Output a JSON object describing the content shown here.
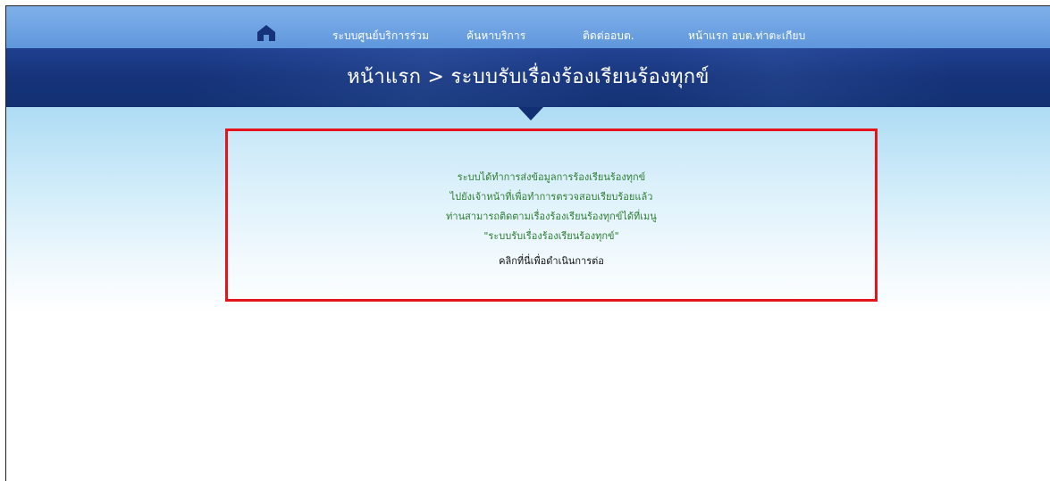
{
  "nav": {
    "home_icon": "home-icon",
    "items": [
      {
        "label": "ระบบศูนย์บริการร่วม"
      },
      {
        "label": "ค้นหาบริการ"
      },
      {
        "label": "ติดต่ออบต."
      },
      {
        "label": "หน้าแรก อบต.ท่าตะเกียบ"
      }
    ]
  },
  "banner": {
    "title": "หน้าแรก > ระบบรับเรื่องร้องเรียนร้องทุกข์"
  },
  "notice": {
    "lines": [
      "ระบบได้ทำการส่งข้อมูลการร้องเรียนร้องทุกข์",
      "ไปยังเจ้าหน้าที่เพื่อทำการตรวจสอบเรียบร้อยแล้ว",
      "ท่านสามารถติดตามเรื่องร้องเรียนร้องทุกข์ได้ที่เมนู",
      "\"ระบบรับเรื่องร้องเรียนร้องทุกข์\""
    ],
    "continue_link": "คลิกที่นี่เพื่อดำเนินการต่อ"
  },
  "colors": {
    "nav_bg": "#6fa3e3",
    "banner_bg": "#16337a",
    "highlight_border": "#e5141a",
    "message_text": "#2e7d32"
  }
}
